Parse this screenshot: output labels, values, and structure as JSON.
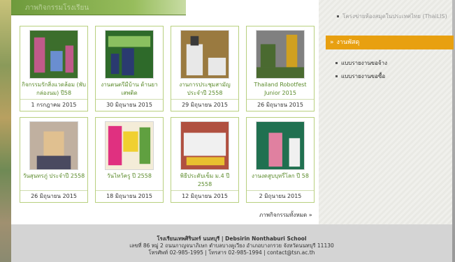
{
  "section": {
    "title": "ภาพกิจกรรมโรงเรียน"
  },
  "activities": [
    {
      "caption": "กิจกรรมรักสิ่งแวดล้อม (พับกล่องนม) ปี58",
      "date": "1 กรกฎาคม 2015",
      "photo_colors": [
        "#3c6e2c",
        "#c05a8a",
        "#6a8ed0"
      ]
    },
    {
      "caption": "งานตนตรีมีบ้าน ด้านยาเสพติด",
      "date": "30 มิถุนายน 2015",
      "photo_colors": [
        "#2e6a2a",
        "#8ac060",
        "#2a3a70"
      ]
    },
    {
      "caption": "งานการประชุมสามัญประจำปี 2558",
      "date": "29 มิถุนายน 2015",
      "photo_colors": [
        "#9a7a40",
        "#e8e8e8",
        "#3a3a3a"
      ]
    },
    {
      "caption": "Thailand Robotfest Junior 2015",
      "date": "26 มิถุนายน 2015",
      "photo_colors": [
        "#808080",
        "#d0a020",
        "#4a6a30"
      ]
    },
    {
      "caption": "วันสุนทรภู่ ประจำปี 2558",
      "date": "26 มิถุนายน 2015",
      "photo_colors": [
        "#c0b0a0",
        "#e0c090",
        "#4a4a60"
      ]
    },
    {
      "caption": "วันไหว้ครู ปี 2558",
      "date": "18 มิถุนายน 2015",
      "photo_colors": [
        "#e03080",
        "#f0d030",
        "#60a040"
      ]
    },
    {
      "caption": "พิธีประดับเข็ม ม.4 ปี 2558",
      "date": "12 มิถุนายน 2015",
      "photo_colors": [
        "#b05040",
        "#f0f0f0",
        "#e8c030"
      ]
    },
    {
      "caption": "งานงดสูบบุหรี่โลก ปี 58",
      "date": "2 มิถุนายน 2015",
      "photo_colors": [
        "#207050",
        "#e080a0",
        "#f0f0f0"
      ]
    }
  ],
  "more_link": "ภาพกิจกรรมทั้งหมด »",
  "sidebar": {
    "top_link": "โครงข่ายห้องสมุดในประเทศไทย (ThaiLIS)",
    "heading": "งานพัสดุ",
    "heading_chevron": "»",
    "links": [
      "แบบรายงานขอจ้าง",
      "แบบรายงานขอซื้อ"
    ]
  },
  "footer": {
    "school": "โรงเรียนเทพศิรินทร์ นนทบุรี | Debsirin Nonthaburi School",
    "address": "เลขที่ 86 หมู่ 2 ถนนกาญจนาภิเษก ตำบลบางคูเวียง อำเภอบางกรวย จังหวัดนนทบุรี 11130",
    "contact": "โทรศัพท์ 02-985-1995 | โทรสาร 02-985-1994 | contact@tsn.ac.th"
  }
}
